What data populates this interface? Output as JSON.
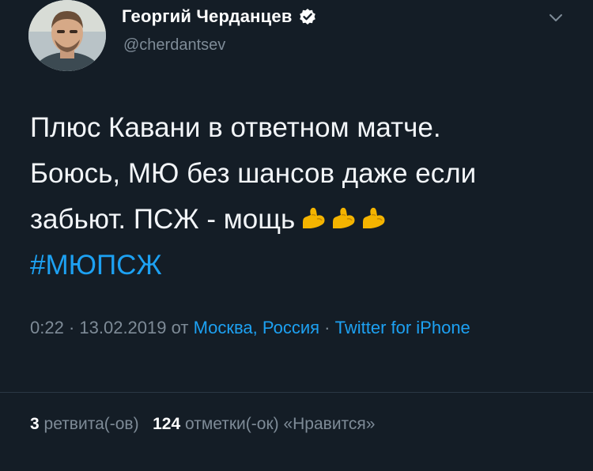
{
  "author": {
    "display_name": "Георгий Черданцев",
    "handle": "@cherdantsev",
    "verified": true
  },
  "tweet": {
    "lines": [
      "Плюс Кавани в ответном матче.",
      "Боюсь, МЮ без шансов даже если",
      "забьют. ПСЖ - мощь"
    ],
    "emoji": "flexed-biceps-icon x3",
    "hashtag": "#МЮПСЖ"
  },
  "meta": {
    "time": "0:22",
    "sep1": " · ",
    "date": "13.02.2019",
    "from": " от ",
    "location": "Москва, Россия",
    "sep2": " · ",
    "source": "Twitter for iPhone"
  },
  "stats": {
    "retweets_count": "3",
    "retweets_label": "ретвита(-ов)",
    "likes_count": "124",
    "likes_label": "отметки(-ок) «Нравится»"
  },
  "colors": {
    "background": "#141d26",
    "link": "#1da1f2",
    "secondary": "#7e8b97"
  }
}
